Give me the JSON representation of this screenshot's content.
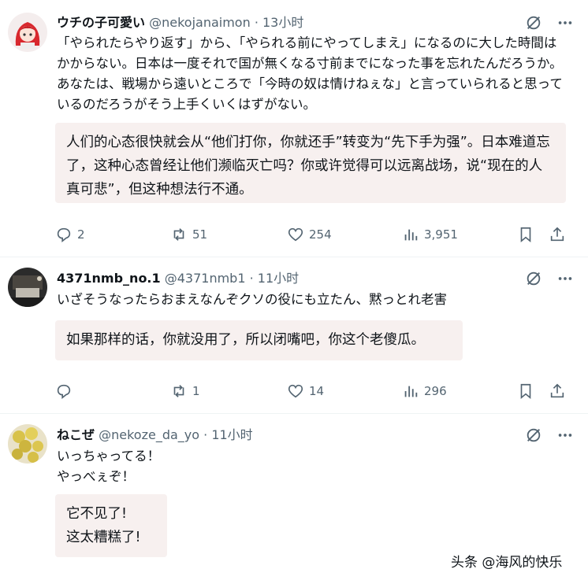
{
  "posts": [
    {
      "name": "ウチの子可愛い",
      "handle": "@nekojanaimon",
      "time": "· 13小时",
      "text": "「やられたらやり返す」から、「やられる前にやってしまえ」になるのに大した時間はかからない。日本は一度それで国が無くなる寸前までになった事を忘れたんだろうか。あなたは、戦場から遠いところで「今時の奴は情けねぇな」と言っていられると思っているのだろうがそう上手くいくはずがない。",
      "translation": "人们的心态很快就会从“他们打你，你就还手”转变为“先下手为强”。日本难道忘了，这种心态曾经让他们濒临灭亡吗？你或许觉得可以远离战场，说“现在的人真可悲”，但这种想法行不通。",
      "stats": {
        "replies": "2",
        "reposts": "51",
        "likes": "254",
        "views": "3,951"
      }
    },
    {
      "name": "4371nmb_no.1",
      "handle": "@4371nmb1",
      "time": "· 11小时",
      "text": "いざそうなったらおまえなんぞクソの役にも立たん、黙っとれ老害",
      "translation": "如果那样的话，你就没用了，所以闭嘴吧，你这个老傻瓜。",
      "stats": {
        "replies": "",
        "reposts": "1",
        "likes": "14",
        "views": "296"
      }
    },
    {
      "name": "ねこぜ",
      "handle": "@nekoze_da_yo",
      "time": "· 11小时",
      "text_lines": [
        "いっちゃってる！",
        "やっべぇぞ！"
      ],
      "translation_lines": [
        "它不见了!",
        "这太糟糕了!"
      ]
    }
  ],
  "watermark": "头条 @海风的快乐",
  "colors": {
    "text": "#0f1419",
    "muted": "#536471",
    "translation_bg": "#f7f0ef",
    "divider": "#eff3f4"
  }
}
